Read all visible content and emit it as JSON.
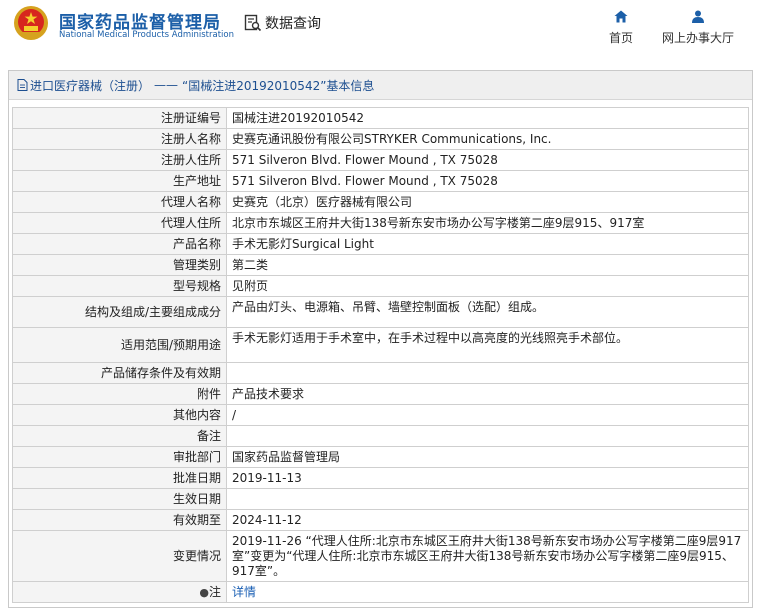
{
  "header": {
    "site_name_cn": "国家药品监督管理局",
    "site_name_en": "National Medical Products Administration",
    "query_label": "数据查询",
    "nav": {
      "home_label": "首页",
      "hall_label": "网上办事大厅"
    }
  },
  "panel": {
    "title_part1": "进口医疗器械（注册）",
    "title_sep": "——",
    "title_part2": "“国械注进20192010542”基本信息"
  },
  "rows": [
    {
      "label": "注册证编号",
      "value": "国械注进20192010542"
    },
    {
      "label": "注册人名称",
      "value": "史赛克通讯股份有限公司STRYKER Communications, Inc."
    },
    {
      "label": "注册人住所",
      "value": "571 Silveron Blvd. Flower Mound , TX 75028"
    },
    {
      "label": "生产地址",
      "value": "571 Silveron Blvd. Flower Mound , TX 75028"
    },
    {
      "label": "代理人名称",
      "value": "史赛克（北京）医疗器械有限公司"
    },
    {
      "label": "代理人住所",
      "value": "北京市东城区王府井大街138号新东安市场办公写字楼第二座9层915、917室"
    },
    {
      "label": "产品名称",
      "value": "手术无影灯Surgical Light"
    },
    {
      "label": "管理类别",
      "value": "第二类"
    },
    {
      "label": "型号规格",
      "value": "见附页"
    },
    {
      "label": "结构及组成/主要组成成分",
      "value": "产品由灯头、电源箱、吊臂、墙壁控制面板（选配）组成。"
    },
    {
      "label": "适用范围/预期用途",
      "value": "手术无影灯适用于手术室中，在手术过程中以高亮度的光线照亮手术部位。"
    },
    {
      "label": "产品储存条件及有效期",
      "value": ""
    },
    {
      "label": "附件",
      "value": "产品技术要求"
    },
    {
      "label": "其他内容",
      "value": "/"
    },
    {
      "label": "备注",
      "value": ""
    },
    {
      "label": "审批部门",
      "value": "国家药品监督管理局"
    },
    {
      "label": "批准日期",
      "value": "2019-11-13"
    },
    {
      "label": "生效日期",
      "value": ""
    },
    {
      "label": "有效期至",
      "value": "2024-11-12"
    },
    {
      "label": "变更情况",
      "value": "2019-11-26 “代理人住所:北京市东城区王府井大街138号新东安市场办公写字楼第二座9层917室”变更为“代理人住所:北京市东城区王府井大街138号新东安市场办公写字楼第二座9层915、917室”。"
    },
    {
      "label": "注",
      "value": "详情"
    }
  ]
}
